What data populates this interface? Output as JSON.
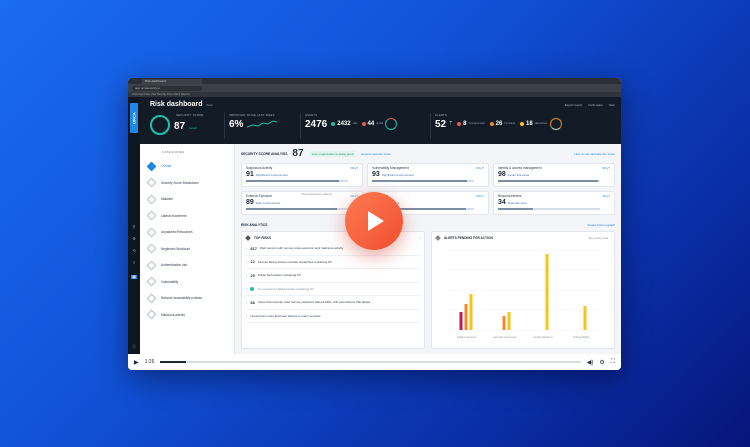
{
  "browser": {
    "tab_title": "Risk dashboard",
    "url": "app.orcasecurity.io",
    "bookmarks": "Orca login   Fleet view   Security   Docs   Alerts   Reports"
  },
  "brand": {
    "logo_text": "ORCA"
  },
  "header": {
    "title": "Risk dashboard",
    "subtitle": "Beta",
    "actions": [
      "Export report",
      "Invite team",
      "Help"
    ],
    "metrics": {
      "security_score_label": "SECURITY SCORE",
      "security_score": "87",
      "security_score_grade": "Good",
      "improved_label": "IMPROVED SINCE LAST WEEK",
      "improved_value": "6%",
      "assets_label": "ASSETS",
      "assets_total": "2476",
      "assets_safe": "2432",
      "assets_safe_label": "safe",
      "assets_risky": "44",
      "assets_risky_label": "at risk",
      "alerts_label": "ALERTS",
      "alerts_total": "52",
      "alerts_critical": "8",
      "alerts_critical_label": "Compromised",
      "alerts_high": "26",
      "alerts_high_label": "Imminent",
      "alerts_medium": "18",
      "alerts_medium_label": "Hazardous"
    }
  },
  "sidebar": {
    "heading": "CATEGORIES",
    "items": [
      {
        "label": "Overall"
      },
      {
        "label": "Security Score Breakdown"
      },
      {
        "label": "Malware"
      },
      {
        "label": "Lateral movement"
      },
      {
        "label": "Unpatched Resources"
      },
      {
        "label": "Neglected Workload"
      },
      {
        "label": "Authentication risk"
      },
      {
        "label": "Vulnerability"
      },
      {
        "label": "Network accessibility policies"
      },
      {
        "label": "Malicious activity"
      }
    ]
  },
  "score_analysis": {
    "title": "SECURITY SCORE ANALYSIS",
    "value": "87",
    "status": "Your organization is doing good",
    "compare_link": "Explore security score",
    "how_link": "How do we calculate the score",
    "cards": [
      {
        "name": "Suspicious Activity",
        "value": "91",
        "note": "Significant Improvement",
        "link": "Why?",
        "fill": 0.91
      },
      {
        "name": "Vulnerability Management",
        "value": "93",
        "note": "Significant Improvement",
        "link": "Why?",
        "fill": 0.93
      },
      {
        "name": "Identity & access management",
        "value": "98",
        "note": "Looks this week",
        "link": "Why?",
        "fill": 0.98
      },
      {
        "name": "External Exposure",
        "value": "89",
        "note": "High improvement",
        "link": "Why?",
        "extra": "External Exposure explained",
        "fill": 0.89
      },
      {
        "name": "Data at risk",
        "value": "92",
        "note": "Improvement",
        "link": "Why?",
        "fill": 0.92
      },
      {
        "name": "Responsiveness",
        "value": "34",
        "note": "Dramatic drop",
        "link": "Why?",
        "fill": 0.34
      }
    ]
  },
  "risk_analytics": {
    "title": "RISK ANALYTICS",
    "link": "Create custom graph",
    "top_risks": {
      "title": "TOP RISKS",
      "rows": [
        {
          "count": "817",
          "text": "Web servers with remote code execution and malicious activity"
        },
        {
          "count": "12",
          "text": "Internet facing assets override unpatched containing PII"
        },
        {
          "count": "25",
          "text": "Public S3 buckets containing PII"
        },
        {
          "count": "",
          "text": "You resolved 4 failed assets containing PII",
          "resolved": true
        },
        {
          "count": "88",
          "text": "Users that recently used remote password without MFA, with permissions that allows..."
        },
        {
          "count": "",
          "text": "Unused Iam roles that have access to many services"
        }
      ]
    },
    "alerts_chart": {
      "title": "ALERTS PENDING FOR ACTION",
      "filter": "By severity lists"
    }
  },
  "chart_data": {
    "type": "bar",
    "title": "ALERTS PENDING FOR ACTION",
    "categories": [
      "Data exposure",
      "Lateral movement",
      "Authentication",
      "Vulnerability"
    ],
    "series": [
      {
        "name": "",
        "color": "#c2185b",
        "values": [
          9,
          0,
          0,
          0
        ]
      },
      {
        "name": "",
        "color": "#f08a24",
        "values": [
          13,
          7,
          0,
          0
        ]
      },
      {
        "name": "",
        "color": "#f5c518",
        "values": [
          18,
          9,
          38,
          12
        ]
      }
    ],
    "ylim": [
      0,
      40
    ]
  },
  "player": {
    "time": "1:26",
    "progress": 0.06,
    "play_button_color": "#f04f2f"
  }
}
